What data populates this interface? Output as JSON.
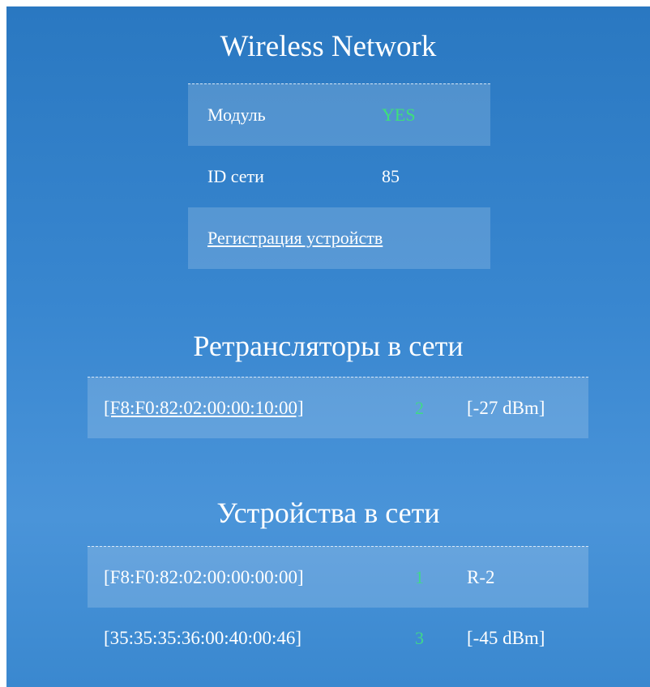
{
  "wireless": {
    "title": "Wireless Network",
    "module_label": "Модуль",
    "module_value": "YES",
    "network_id_label": "ID сети",
    "network_id_value": "85",
    "register_link": "Регистрация устройств"
  },
  "repeaters": {
    "title": "Ретрансляторы в сети",
    "items": [
      {
        "mac": "[F8:F0:82:02:00:00:10:00]",
        "num": "2",
        "signal": "[-27 dBm]"
      }
    ]
  },
  "devices": {
    "title": "Устройства в сети",
    "items": [
      {
        "mac": "[F8:F0:82:02:00:00:00:00]",
        "num": "1",
        "signal": "R-2"
      },
      {
        "mac": "[35:35:35:36:00:40:00:46]",
        "num": "3",
        "signal": "[-45 dBm]"
      }
    ]
  },
  "colors": {
    "accent_green": "#3ee07a",
    "panel_blue": "#3987d0"
  }
}
